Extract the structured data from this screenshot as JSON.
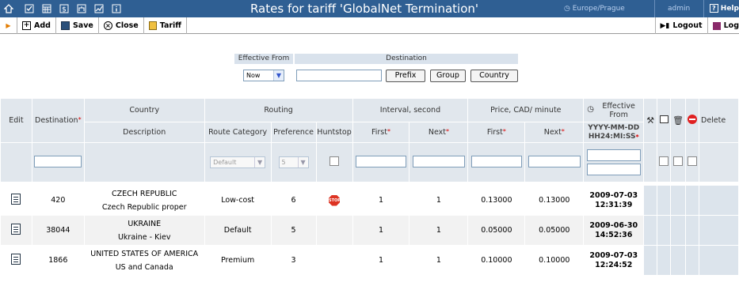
{
  "window": {
    "title": "Rates for tariff 'GlobalNet Termination'",
    "timezone": "Europe/Prague",
    "user": "admin",
    "help": "Help"
  },
  "toolbar": {
    "add": "Add",
    "save": "Save",
    "close": "Close",
    "tariff": "Tariff",
    "logout": "Logout",
    "log": "Log"
  },
  "filter": {
    "effective_from_label": "Effective From",
    "effective_from_value": "Now",
    "destination_label": "Destination",
    "destination_value": "",
    "prefix_button": "Prefix",
    "group_button": "Group",
    "country_button": "Country"
  },
  "table": {
    "headers": {
      "edit": "Edit",
      "destination": "Destination",
      "country": "Country",
      "description": "Description",
      "routing": "Routing",
      "route_category": "Route Category",
      "preference": "Preference",
      "huntstop": "Huntstop",
      "interval": "Interval, second",
      "first": "First",
      "next": "Next",
      "price": "Price, CAD/ minute",
      "effective_from": "Effective From",
      "date_format": "YYYY-MM-DD HH24:MI:SS",
      "delete": "Delete"
    },
    "filter_row": {
      "route_category": "Default",
      "preference": "5"
    },
    "rows": [
      {
        "destination": "420",
        "country": "CZECH REPUBLIC",
        "description": "Czech Republic proper",
        "route_category": "Low-cost",
        "preference": "6",
        "huntstop": true,
        "interval_first": "1",
        "interval_next": "1",
        "price_first": "0.13000",
        "price_next": "0.13000",
        "effective_date": "2009-07-03",
        "effective_time": "12:31:39"
      },
      {
        "destination": "38044",
        "country": "UKRAINE",
        "description": "Ukraine - Kiev",
        "route_category": "Default",
        "preference": "5",
        "huntstop": false,
        "interval_first": "1",
        "interval_next": "1",
        "price_first": "0.05000",
        "price_next": "0.05000",
        "effective_date": "2009-06-30",
        "effective_time": "14:52:36"
      },
      {
        "destination": "1866",
        "country": "UNITED STATES OF AMERICA",
        "description": "US and Canada",
        "route_category": "Premium",
        "preference": "3",
        "huntstop": false,
        "interval_first": "1",
        "interval_next": "1",
        "price_first": "0.10000",
        "price_next": "0.10000",
        "effective_date": "2009-07-03",
        "effective_time": "12:24:52"
      }
    ]
  },
  "icons": {
    "stop_text": "STOP"
  },
  "colors": {
    "header_bar": "#2f5f93",
    "table_header": "#e1e7ed",
    "required": "#dd0000",
    "stop": "#dd3322"
  }
}
